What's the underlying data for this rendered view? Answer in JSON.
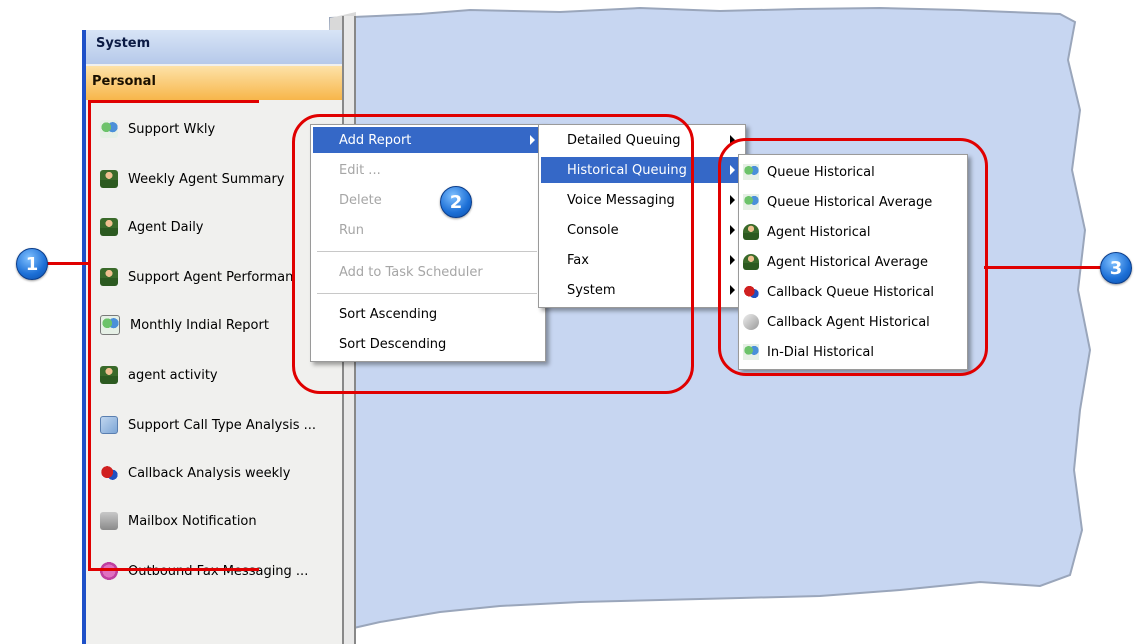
{
  "sidebar": {
    "header_system": "System",
    "header_personal": "Personal",
    "items": [
      {
        "label": "Support Wkly",
        "icon": "group-icon"
      },
      {
        "label": "Weekly Agent Summary",
        "icon": "agent-icon"
      },
      {
        "label": "Agent Daily",
        "icon": "agent-icon"
      },
      {
        "label": "Support Agent Performan",
        "icon": "agent-icon"
      },
      {
        "label": "Monthly Indial Report",
        "icon": "group-icon"
      },
      {
        "label": "agent activity",
        "icon": "agent-icon"
      },
      {
        "label": "Support Call Type Analysis ...",
        "icon": "report-icon"
      },
      {
        "label": "Callback Analysis weekly",
        "icon": "callback-icon"
      },
      {
        "label": "Mailbox Notification",
        "icon": "mailbox-icon"
      },
      {
        "label": "Outbound Fax Messaging ...",
        "icon": "fax-icon"
      }
    ]
  },
  "context_menu": {
    "items": [
      {
        "label": "Add Report",
        "state": "highlighted",
        "submenu": true
      },
      {
        "label": "Edit ...",
        "state": "disabled"
      },
      {
        "label": "Delete",
        "state": "disabled"
      },
      {
        "label": "Run",
        "state": "disabled"
      },
      {
        "label": "Add to Task Scheduler",
        "state": "disabled"
      },
      {
        "label": "Sort Ascending",
        "state": "enabled"
      },
      {
        "label": "Sort Descending",
        "state": "enabled"
      }
    ]
  },
  "report_type_menu": {
    "items": [
      {
        "label": "Detailed Queuing",
        "state": "enabled"
      },
      {
        "label": "Historical Queuing",
        "state": "highlighted"
      },
      {
        "label": "Voice Messaging",
        "state": "enabled"
      },
      {
        "label": "Console",
        "state": "enabled"
      },
      {
        "label": "Fax",
        "state": "enabled"
      },
      {
        "label": "System",
        "state": "enabled"
      }
    ]
  },
  "historical_menu": {
    "items": [
      {
        "label": "Queue Historical",
        "icon": "group-icon"
      },
      {
        "label": "Queue Historical Average",
        "icon": "group-icon"
      },
      {
        "label": "Agent Historical",
        "icon": "agent-icon"
      },
      {
        "label": "Agent Historical Average",
        "icon": "agent-icon"
      },
      {
        "label": "Callback Queue Historical",
        "icon": "callback-icon"
      },
      {
        "label": "Callback Agent Historical",
        "icon": "handset-icon"
      },
      {
        "label": "In-Dial Historical",
        "icon": "group-icon"
      }
    ]
  },
  "annotations": {
    "badge_1": "1",
    "badge_2": "2",
    "badge_3": "3",
    "color": "#e00000"
  },
  "colors": {
    "highlight": "#3568c7",
    "page_background": "#c8d7f0",
    "personal_header": "#f7b64a",
    "system_header": "#b6c9ea"
  }
}
